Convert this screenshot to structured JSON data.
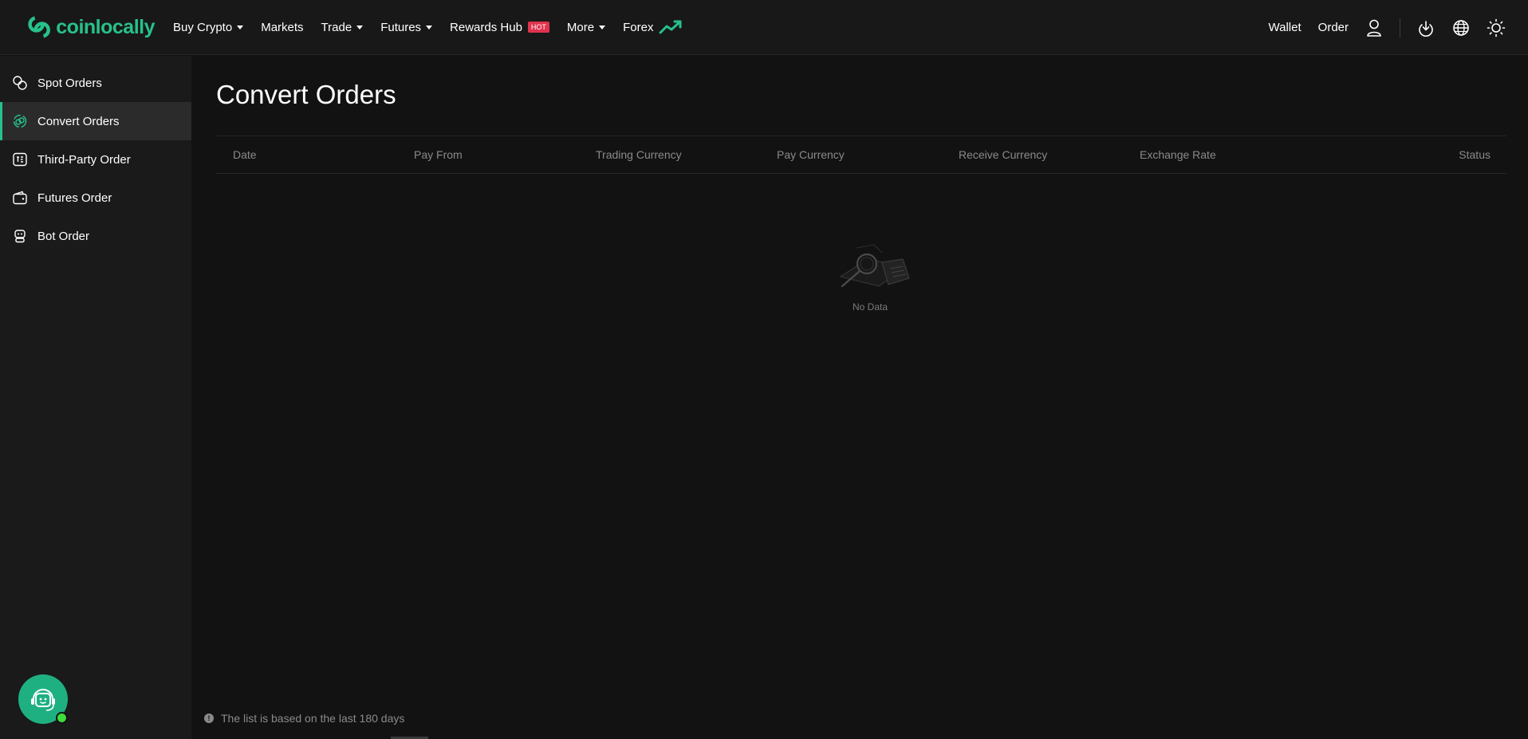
{
  "brand": {
    "name": "coinlocally",
    "color": "#27c18a"
  },
  "nav": [
    {
      "label": "Buy Crypto",
      "dropdown": true
    },
    {
      "label": "Markets",
      "dropdown": false
    },
    {
      "label": "Trade",
      "dropdown": true
    },
    {
      "label": "Futures",
      "dropdown": true
    },
    {
      "label": "Rewards Hub",
      "dropdown": false,
      "badge": "HOT"
    },
    {
      "label": "More",
      "dropdown": true
    },
    {
      "label": "Forex",
      "dropdown": false
    }
  ],
  "top_right": {
    "wallet": "Wallet",
    "order": "Order"
  },
  "sidebar": {
    "items": [
      {
        "label": "Spot Orders",
        "icon": "spot-orders-icon"
      },
      {
        "label": "Convert Orders",
        "icon": "convert-orders-icon",
        "active": true
      },
      {
        "label": "Third-Party Order",
        "icon": "third-party-order-icon"
      },
      {
        "label": "Futures Order",
        "icon": "wallet-icon"
      },
      {
        "label": "Bot Order",
        "icon": "bot-icon"
      }
    ]
  },
  "main": {
    "title": "Convert Orders",
    "columns": [
      "Date",
      "Pay From",
      "Trading Currency",
      "Pay Currency",
      "Receive Currency",
      "Exchange Rate",
      "Status"
    ],
    "empty_text": "No Data",
    "footnote": "The list is based on the last 180 days"
  },
  "colors": {
    "accent": "#27c18a",
    "hot": "#e0334f",
    "background": "#121212",
    "sidebar": "#1a1a1a"
  }
}
